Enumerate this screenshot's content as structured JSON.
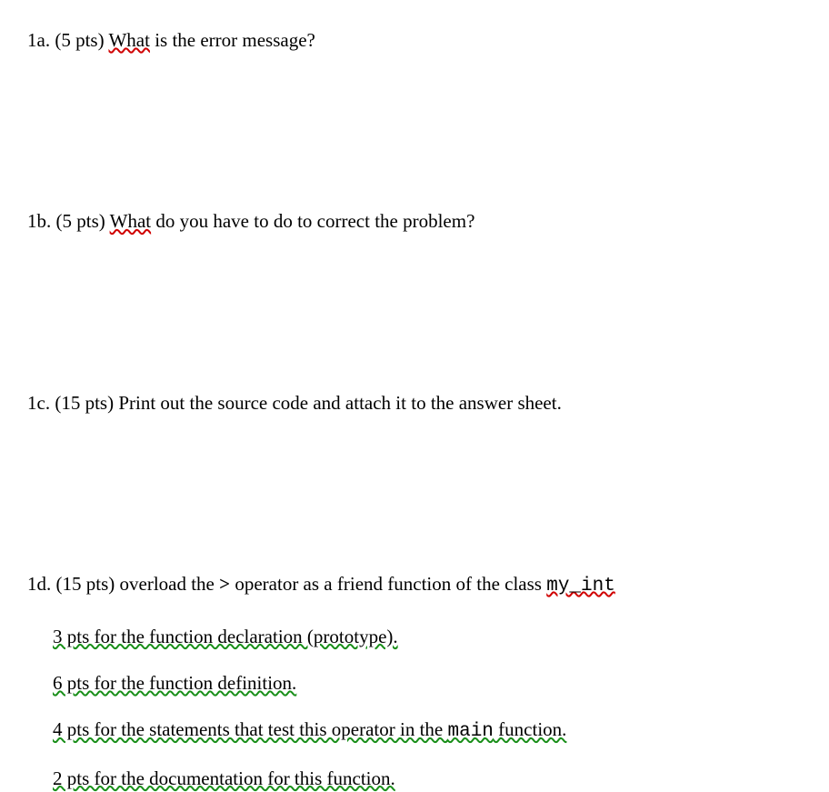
{
  "questions": {
    "a": {
      "label": "1a. ",
      "pts": "(5 pts) ",
      "what": "What",
      "rest": " is the error message?"
    },
    "b": {
      "label": "1b. ",
      "pts": "(5 pts) ",
      "what": "What",
      "rest": " do you have to do to correct the problem?"
    },
    "c": {
      "label": "1c. ",
      "pts": "(15 pts) ",
      "rest": "Print out the source code and attach it to the answer sheet."
    },
    "d": {
      "label": "1d. ",
      "pts": "(15 pts) ",
      "text1": "overload the ",
      "op": ">",
      "text2": " operator as a friend function of the class ",
      "classname": "my_int",
      "sub": {
        "s1": "3 pts for the function declaration (prototype).",
        "s2": "6 pts for the function definition.",
        "s3a": "4 pts for the statements that test this operator in the ",
        "s3b": "main",
        "s3c": " function.",
        "s4": "2 pts for the documentation for this function."
      }
    }
  }
}
